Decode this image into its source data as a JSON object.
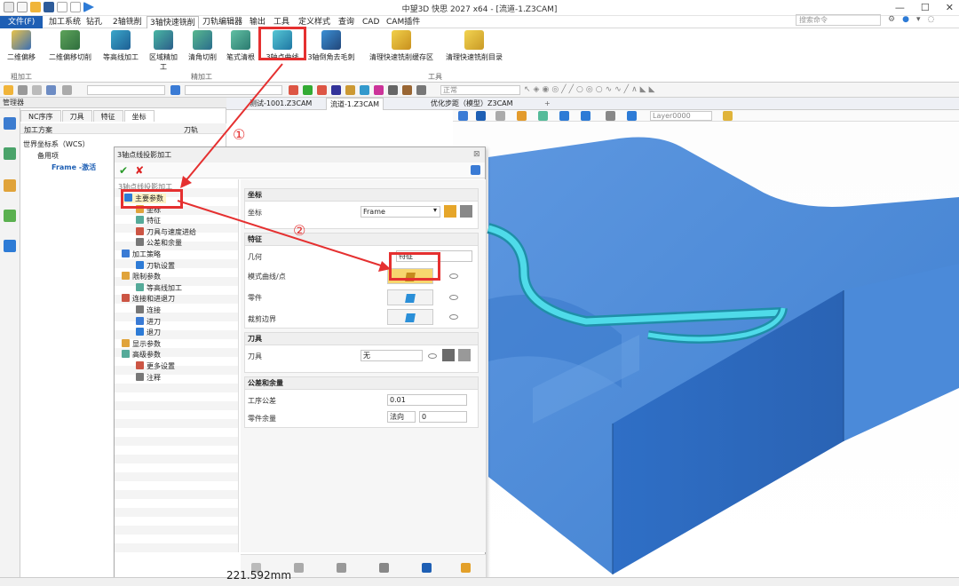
{
  "window": {
    "title": "中望3D 快思 2027 x64 - [流道-1.Z3CAM]",
    "search_placeholder": "搜索命令"
  },
  "menu": {
    "items": [
      "文件(F)",
      "加工系统",
      "钻孔",
      "2轴铣削",
      "3轴快速铣削",
      "刀轨编辑器",
      "输出",
      "工具",
      "定义样式",
      "查询",
      "CAD",
      "CAM插件"
    ],
    "active_index": 4
  },
  "ribbon": {
    "buttons": [
      "二维偏移",
      "二维偏移切削",
      "等高线加工",
      "区域精加工",
      "清角切削",
      "笔式清根",
      "3轴点曲线",
      "3轴倒角去毛刺",
      "清理快速铣削缓存区",
      "清理快速铣削目录"
    ],
    "groups": [
      "粗加工",
      "精加工",
      "工具"
    ],
    "highlighted_button": "3轴点曲线"
  },
  "toolbar": {
    "layer_value": "Layer0000",
    "mode_value": "正常"
  },
  "left_panel": {
    "header": "管理器",
    "tabs": [
      "NC序序",
      "刀具",
      "特征",
      "坐标"
    ],
    "active_tab": "坐标",
    "tree": {
      "col1": "加工方案",
      "col2": "刀轨",
      "root": "世界坐标系（WCS）",
      "child1": "备用项",
      "child2": "Frame -激活"
    }
  },
  "doc_tabs": [
    "测试-1001.Z3CAM",
    "流道-1.Z3CAM",
    "优化步距（模型）Z3CAM"
  ],
  "active_doc_tab": 1,
  "dialog": {
    "title": "3轴点线投影加工",
    "tree_title": "3轴点线投影加工",
    "tree": [
      {
        "label": "主要参数",
        "level": 1,
        "highlight": true
      },
      {
        "label": "坐标",
        "level": 2
      },
      {
        "label": "特征",
        "level": 2
      },
      {
        "label": "刀具与速度进给",
        "level": 2
      },
      {
        "label": "公差和余量",
        "level": 2
      },
      {
        "label": "加工策略",
        "level": 1
      },
      {
        "label": "刀轨设置",
        "level": 2
      },
      {
        "label": "限制参数",
        "level": 1
      },
      {
        "label": "等高线加工",
        "level": 2
      },
      {
        "label": "连接和进退刀",
        "level": 1
      },
      {
        "label": "连接",
        "level": 2
      },
      {
        "label": "进刀",
        "level": 2
      },
      {
        "label": "退刀",
        "level": 2
      },
      {
        "label": "显示参数",
        "level": 1
      },
      {
        "label": "高级参数",
        "level": 1
      },
      {
        "label": "更多设置",
        "level": 2
      },
      {
        "label": "注释",
        "level": 2
      }
    ],
    "sections": {
      "coord": {
        "title": "坐标",
        "label": "坐标",
        "value": "Frame"
      },
      "feature": {
        "title": "特征",
        "geom_label": "几何",
        "geom_value": "特征",
        "curve_label": "模式曲线/点",
        "part_label": "零件",
        "trim_label": "裁剪边界"
      },
      "tool": {
        "title": "刀具",
        "label": "刀具",
        "value": "无"
      },
      "tolerance": {
        "title": "公差和余量",
        "tol_label": "工序公差",
        "tol_value": "0.01",
        "stock_label": "零件余量",
        "stock_dir": "法向",
        "stock_value": "0"
      }
    }
  },
  "callouts": [
    "①",
    "②"
  ],
  "status": {
    "measure": "221.592mm"
  },
  "colors": {
    "accent": "#1e5fb4",
    "highlight": "#e53030",
    "model": "#4a88d6",
    "channel": "#35c9dc"
  }
}
